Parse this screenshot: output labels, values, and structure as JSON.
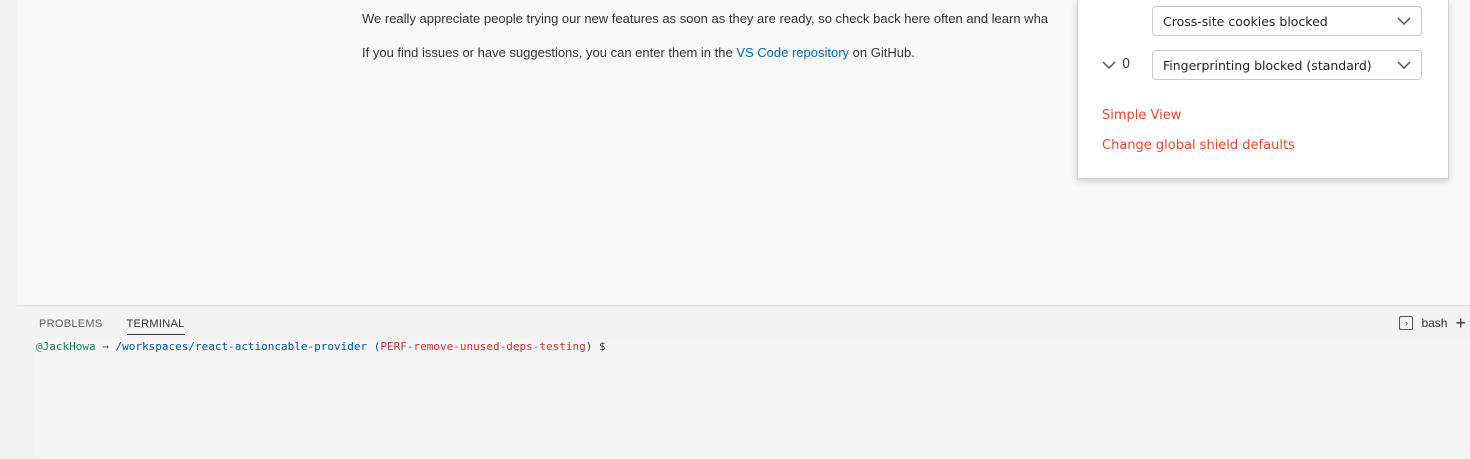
{
  "editor": {
    "paragraph1": "We really appreciate people trying our new features as soon as they are ready, so check back here often and learn wha",
    "paragraph2_prefix": "If you find issues or have suggestions, you can enter them in the ",
    "paragraph2_link": "VS Code repository",
    "paragraph2_suffix": " on GitHub."
  },
  "shields_popup": {
    "cookies_select": "Cross-site cookies blocked",
    "fingerprinting_count": "0",
    "fingerprinting_select": "Fingerprinting blocked (standard)",
    "simple_view": "Simple View",
    "change_defaults": "Change global shield defaults",
    "accent_color": "#f0442a"
  },
  "panel": {
    "tabs": [
      {
        "label": "PROBLEMS",
        "active": false
      },
      {
        "label": "TERMINAL",
        "active": true
      }
    ],
    "shell_label": "bash"
  },
  "terminal": {
    "user": "@JackHowa",
    "arrow": " → ",
    "path": "/workspaces/react-actioncable-provider",
    "branch_open": " (",
    "branch": "PERF-remove-unused-deps-testing",
    "branch_close": ")",
    "prompt": " $"
  }
}
